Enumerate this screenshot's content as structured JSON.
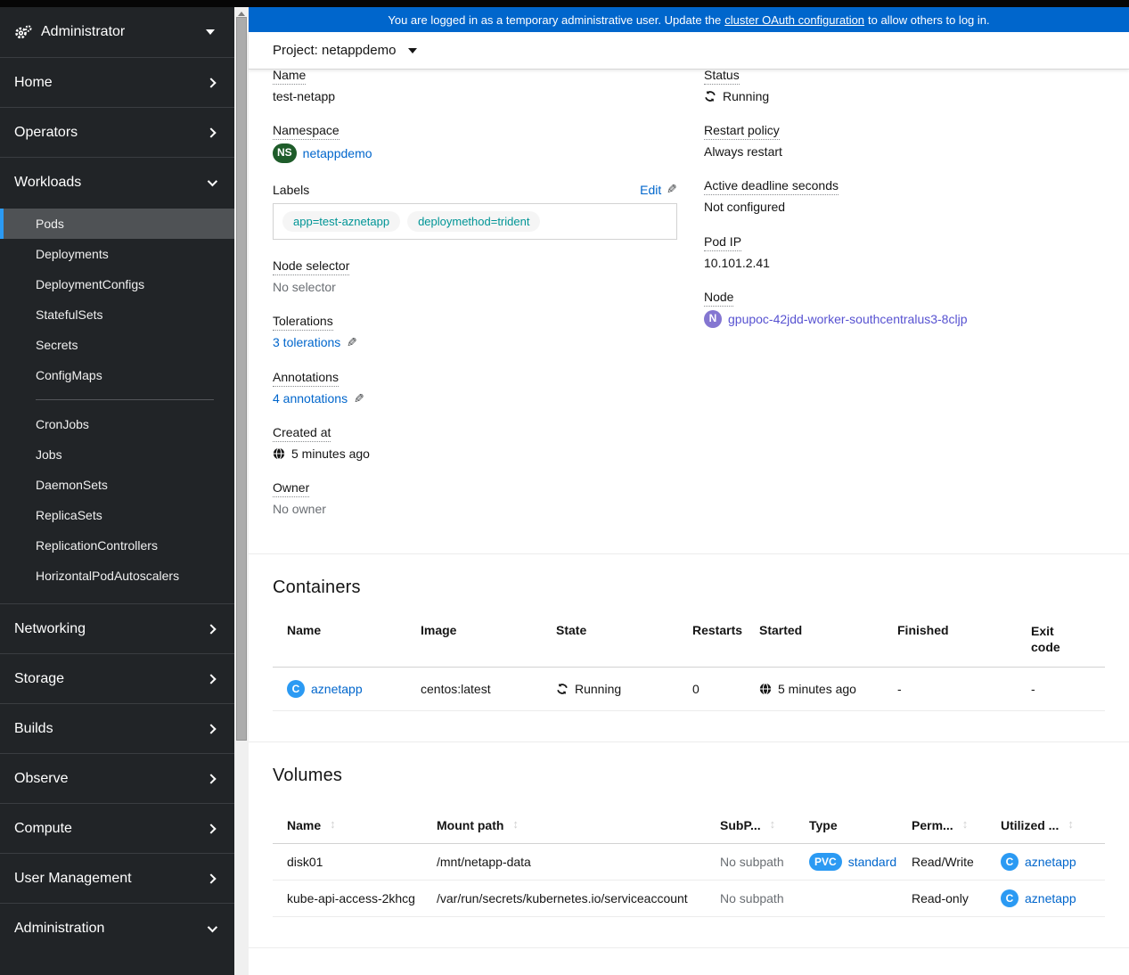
{
  "banner": {
    "pre": "You are logged in as a temporary administrative user. Update the",
    "link": "cluster OAuth configuration",
    "post": "to allow others to log in."
  },
  "project_bar": {
    "label": "Project: netappdemo"
  },
  "sidebar": {
    "perspective": "Administrator",
    "home": "Home",
    "operators": "Operators",
    "workloads": "Workloads",
    "workloads_items": [
      "Pods",
      "Deployments",
      "DeploymentConfigs",
      "StatefulSets",
      "Secrets",
      "ConfigMaps",
      "CronJobs",
      "Jobs",
      "DaemonSets",
      "ReplicaSets",
      "ReplicationControllers",
      "HorizontalPodAutoscalers"
    ],
    "networking": "Networking",
    "storage": "Storage",
    "builds": "Builds",
    "observe": "Observe",
    "compute": "Compute",
    "user_management": "User Management",
    "administration": "Administration"
  },
  "details": {
    "name": {
      "label": "Name",
      "value": "test-netapp"
    },
    "namespace": {
      "label": "Namespace",
      "badge": "NS",
      "value": "netappdemo"
    },
    "labels": {
      "label": "Labels",
      "edit": "Edit",
      "items": [
        "app=test-aznetapp",
        "deploymethod=trident"
      ]
    },
    "node_selector": {
      "label": "Node selector",
      "value": "No selector"
    },
    "tolerations": {
      "label": "Tolerations",
      "value": "3 tolerations"
    },
    "annotations": {
      "label": "Annotations",
      "value": "4 annotations"
    },
    "created_at": {
      "label": "Created at",
      "value": "5 minutes ago"
    },
    "owner": {
      "label": "Owner",
      "value": "No owner"
    },
    "status": {
      "label": "Status",
      "value": "Running"
    },
    "restart_policy": {
      "label": "Restart policy",
      "value": "Always restart"
    },
    "active_deadline": {
      "label": "Active deadline seconds",
      "value": "Not configured"
    },
    "pod_ip": {
      "label": "Pod IP",
      "value": "10.101.2.41"
    },
    "node": {
      "label": "Node",
      "badge": "N",
      "value": "gpupoc-42jdd-worker-southcentralus3-8cljp"
    }
  },
  "containers": {
    "title": "Containers",
    "headers": {
      "name": "Name",
      "image": "Image",
      "state": "State",
      "restarts": "Restarts",
      "started": "Started",
      "finished": "Finished",
      "exit_code": "Exit code"
    },
    "row": {
      "badge": "C",
      "name": "aznetapp",
      "image": "centos:latest",
      "state": "Running",
      "restarts": "0",
      "started": "5 minutes ago",
      "finished": "-",
      "exit_code": "-"
    }
  },
  "volumes": {
    "title": "Volumes",
    "headers": {
      "name": "Name",
      "mount_path": "Mount path",
      "subpath": "SubP...",
      "type": "Type",
      "permissions": "Perm...",
      "utilized": "Utilized ..."
    },
    "rows": [
      {
        "name": "disk01",
        "mount_path": "/mnt/netapp-data",
        "subpath": "No subpath",
        "type_badge": "PVC",
        "type_link": "standard",
        "permissions": "Read/Write",
        "utilized_badge": "C",
        "utilized": "aznetapp"
      },
      {
        "name": "kube-api-access-2khcg",
        "mount_path": "/var/run/secrets/kubernetes.io/serviceaccount",
        "subpath": "No subpath",
        "type_badge": "",
        "type_link": "",
        "permissions": "Read-only",
        "utilized_badge": "C",
        "utilized": "aznetapp"
      }
    ]
  },
  "colors": {
    "banner_blue": "#0066cc",
    "link_blue": "#0066cc",
    "active_nav_blue": "#2b9af3",
    "namespace_green": "#1e5c2a",
    "node_purple": "#8476d1",
    "container_blue": "#2b9af3",
    "label_teal": "#009596",
    "sidebar_dark": "#212427"
  }
}
